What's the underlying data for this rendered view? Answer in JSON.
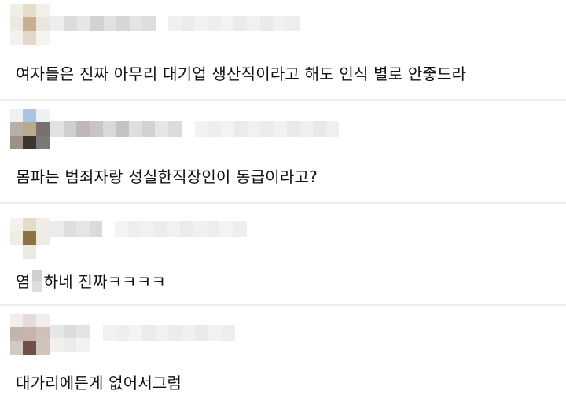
{
  "comments": [
    {
      "text": "여자들은 진짜 아무리 대기업 생산직이라고 해도 인식 별로 안좋드라"
    },
    {
      "text": "몸파는 범죄자랑 성실한직장인이 동급이라고?"
    },
    {
      "text_before": "염",
      "text_after": "하네 진짜ㅋㅋㅋㅋ"
    },
    {
      "text": "대가리에든게 없어서그럼"
    }
  ],
  "colors": {
    "divider": "#ececec",
    "text": "#111111",
    "background": "#ffffff"
  }
}
